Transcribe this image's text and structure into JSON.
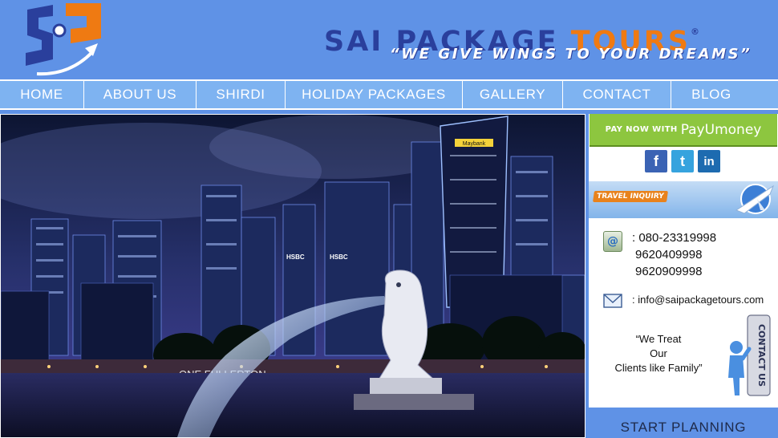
{
  "header": {
    "brand_part1": "SAI PACKAGE ",
    "brand_part2": "TOURS",
    "registered": "®",
    "tagline": "“WE GIVE WINGS TO YOUR DREAMS”",
    "colors": {
      "brand_blue": "#2a3f9c",
      "brand_orange": "#ef7a12",
      "background": "#5f92e6"
    }
  },
  "nav": {
    "items": [
      {
        "label": "HOME"
      },
      {
        "label": "ABOUT US"
      },
      {
        "label": "SHIRDI"
      },
      {
        "label": "HOLIDAY PACKAGES"
      },
      {
        "label": "GALLERY"
      },
      {
        "label": "CONTACT"
      },
      {
        "label": "BLOG"
      }
    ]
  },
  "hero": {
    "image": "singapore-marina-bay-night-skyline",
    "building_signs": [
      "Maybank",
      "HSBC",
      "HSBC",
      "ONE FULLERTON"
    ]
  },
  "sidebar": {
    "pay_now": "PAY NOW WITH",
    "payu": "PayUmoney",
    "socials": [
      "f",
      "t",
      "in"
    ],
    "inquiry_label": "TRAVEL INQUIRY",
    "phone_1": ": 080-23319998",
    "phone_2": "9620409998",
    "phone_3": "9620909998",
    "email": ": info@saipackagetours.com",
    "quote_line1": "“We Treat",
    "quote_line2": "Our",
    "quote_line3": "Clients like Family”",
    "contact_us_sign": "CONTACT US",
    "start_planning": "START PLANNING"
  }
}
